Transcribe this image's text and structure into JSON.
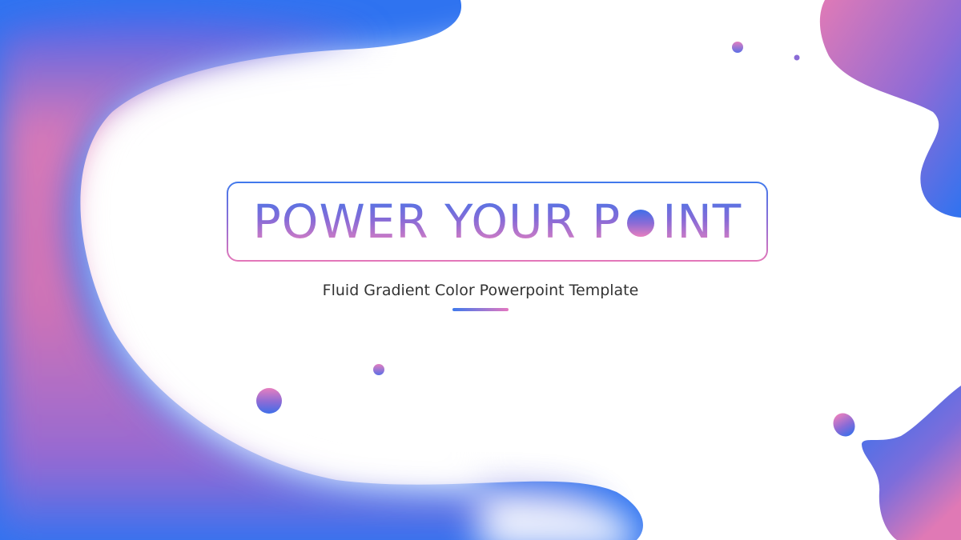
{
  "slide": {
    "title_part1": "POWER YOUR P",
    "title_part2": "INT",
    "subtitle": "Fluid Gradient Color Powerpoint Template"
  },
  "colors": {
    "blue": "#2f73f0",
    "pink": "#e47ab8",
    "purple": "#9a6ad2",
    "text": "#333333",
    "background": "#ffffff"
  },
  "icons": {
    "title_o": "gradient-dot-letter-o"
  }
}
